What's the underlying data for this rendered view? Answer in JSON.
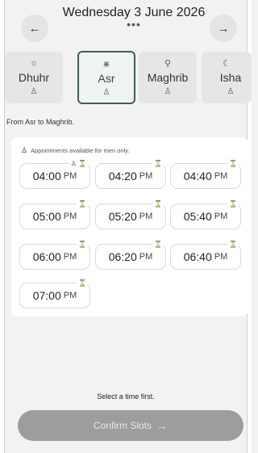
{
  "header": {
    "title": "Wednesday 3 June 2026",
    "more_dots": "•••",
    "prev_icon": "←",
    "next_icon": "→"
  },
  "prayers": [
    {
      "name": "Dhuhr",
      "icon": "☼",
      "foot_icon": "♙",
      "active": false
    },
    {
      "name": "Asr",
      "icon": "⋇",
      "foot_icon": "♙",
      "active": true
    },
    {
      "name": "Maghrib",
      "icon": "⚲",
      "foot_icon": "♙",
      "active": false
    },
    {
      "name": "Isha",
      "icon": "☾",
      "foot_icon": "♙",
      "active": false
    }
  ],
  "range_text": "From Asr to Maghrib.",
  "slots_card": {
    "note": "Appointments available for men only.",
    "slots": [
      {
        "time": "04:00",
        "ampm": "PM",
        "badge": "♙ ⌛"
      },
      {
        "time": "04:20",
        "ampm": "PM",
        "badge": "⌛"
      },
      {
        "time": "04:40",
        "ampm": "PM",
        "badge": "⌛"
      },
      {
        "time": "05:00",
        "ampm": "PM",
        "badge": "⌛"
      },
      {
        "time": "05:20",
        "ampm": "PM",
        "badge": "⌛"
      },
      {
        "time": "05:40",
        "ampm": "PM",
        "badge": "⌛"
      },
      {
        "time": "06:00",
        "ampm": "PM",
        "badge": "⌛"
      },
      {
        "time": "06:20",
        "ampm": "PM",
        "badge": "⌛"
      },
      {
        "time": "06:40",
        "ampm": "PM",
        "badge": "⌛"
      },
      {
        "time": "07:00",
        "ampm": "PM",
        "badge": "⌛"
      }
    ]
  },
  "footer": {
    "hint": "Select a time first.",
    "confirm_label": "Confirm Slots",
    "confirm_arrow": "→"
  },
  "colors": {
    "active_border": "#3f5f50",
    "confirm_disabled": "#9d9d9f"
  }
}
